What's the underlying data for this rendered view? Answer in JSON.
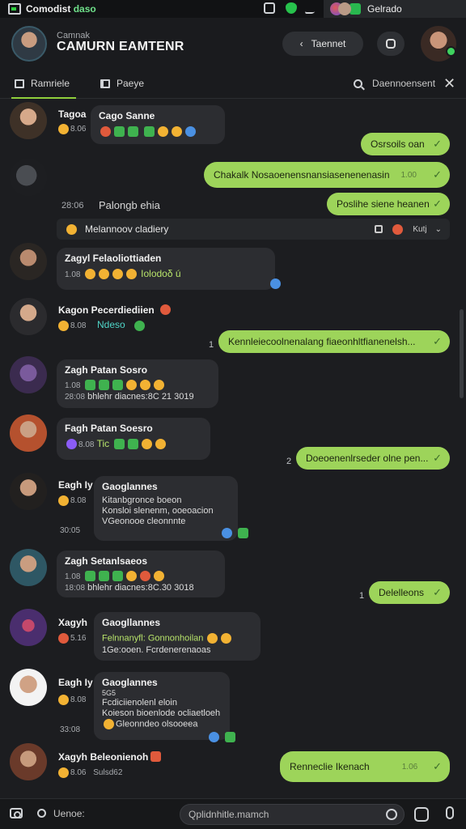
{
  "status": {
    "title": "Comodist",
    "title_accent": "daso",
    "tab_label": "Gelrado"
  },
  "header": {
    "subtitle": "Camnak",
    "title": "CAMURN EAMTENR",
    "back_label": "Taennet"
  },
  "tabs": [
    {
      "label": "Ramriele"
    },
    {
      "label": "Paeye"
    }
  ],
  "search": {
    "label": "Daennoensent"
  },
  "feed": {
    "m1": {
      "name": "Tagoa",
      "meta": "8.06",
      "bubble_title": "Cago Sanne"
    },
    "o1": {
      "text": "Osrsoils oan"
    },
    "o2": {
      "text": "Chakalk Nosaoenensnansiasenenenasin",
      "time": "1.00"
    },
    "sys1": {
      "num": "28:06",
      "text": "Palongb ehia"
    },
    "o3": {
      "text": "Poslihe siene heanen"
    },
    "sysrow": {
      "text": "Melannoov cladiery",
      "dd_label": "Kutj"
    },
    "m2": {
      "name": "Zagyl Felaoliottiaden",
      "meta": "1.08",
      "line": "Iolodoδ ú"
    },
    "m3": {
      "name": "Kagon Pecerdiediien",
      "meta": "8.08",
      "line": "Ndeso"
    },
    "o4": {
      "text": "Kennleiecoolnenalang fiaeonhltfianenelsh...",
      "num": "1"
    },
    "m4": {
      "name": "Zagh Patan Sosro",
      "meta1": "1.08",
      "meta2": "28:08",
      "line": "bhlehr diacnes:8C 21 3019"
    },
    "m5": {
      "name": "Fagh Patan Soesro",
      "meta": "8.08",
      "line": "Tic"
    },
    "o5": {
      "text": "Doeoenenlrseder olne pen...",
      "num": "2"
    },
    "m6": {
      "name": "Eagh Iy",
      "meta1": "8.08",
      "meta2": "30:05",
      "bubble_title": "Gaoglannes",
      "l1": "Kitanbgronce boeon",
      "l2": "Konsloi slenenm, ooeoacion",
      "l3": "VGeonooe cleonnnte"
    },
    "m7": {
      "name": "Zagh Setanlsaeos",
      "meta1": "1.08",
      "meta2": "18:08",
      "line": "bhlehr diacnes:8C.30 3018"
    },
    "o6": {
      "text": "Delelleons",
      "num": "1"
    },
    "m8": {
      "name": "Xagyh",
      "meta": "5.16",
      "bubble_title": "Gaogllannes",
      "l1": "Felnnanyfl: Gonnonhoilan",
      "l2": "1Ge:ooen. Fcrdenerenaoas"
    },
    "m9": {
      "name": "Eagh Iy",
      "meta1": "8.08",
      "meta2": "33:08",
      "bubble_title": "Gaoglannes",
      "l0": "5G5",
      "l1": "Fcdiciienolenl eloin",
      "l2": "Koieson bioenlode ocliaetloeh",
      "l3": "Gleonndeo olsooeea"
    },
    "m10": {
      "name": "Xagyh Beleonienoh",
      "meta": "8.06",
      "meta_b": "Sulsd62"
    },
    "o7": {
      "text": "Renneclie Ikenach",
      "time": "1.06"
    }
  },
  "composer": {
    "left_label": "Uenoe:",
    "placeholder": "Qplidnhitle.mamch"
  }
}
